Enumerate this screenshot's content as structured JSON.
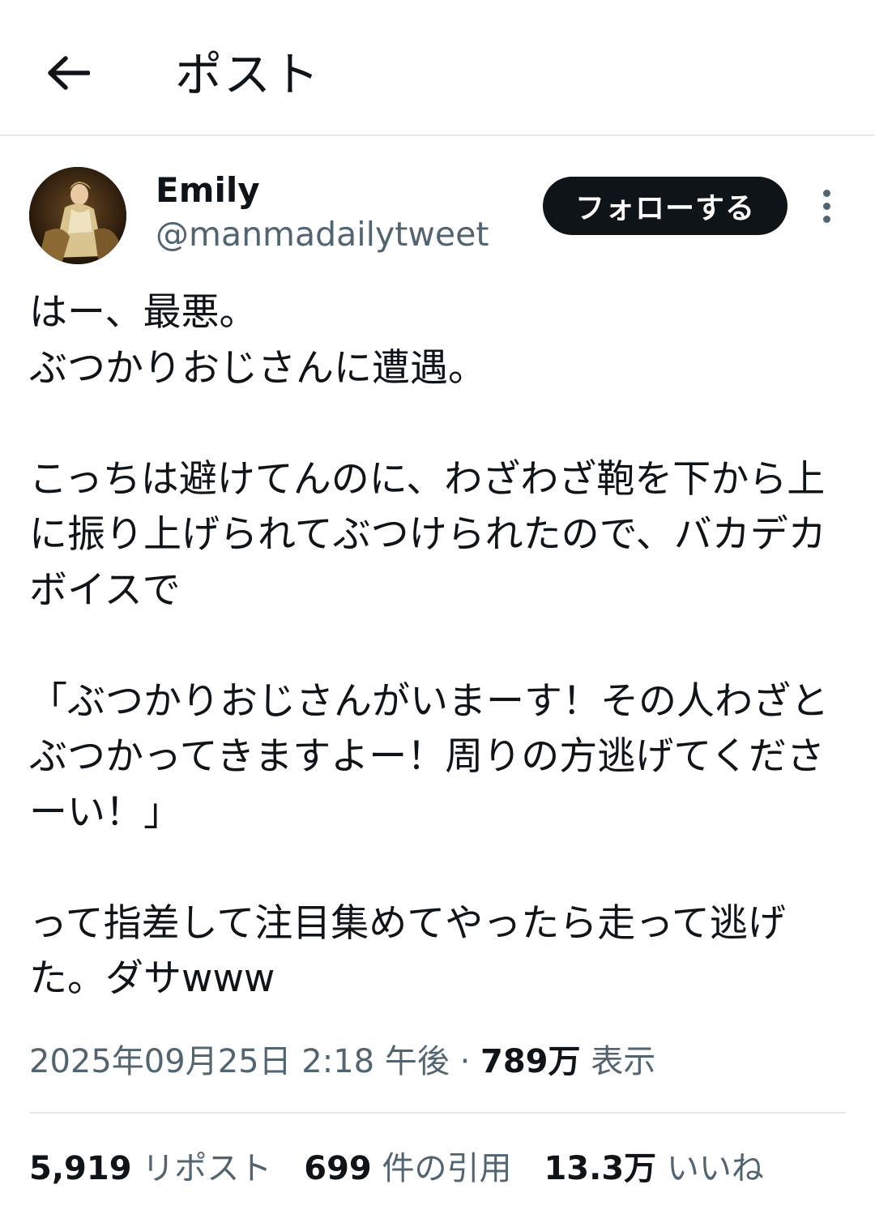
{
  "header": {
    "title": "ポスト",
    "back_icon": "arrow-left-icon"
  },
  "author": {
    "display_name": "Emily",
    "handle": "@manmadailytweet",
    "follow_label": "フォローする"
  },
  "post": {
    "text": "はー、最悪。\nぶつかりおじさんに遭遇。\n\nこっちは避けてんのに、わざわざ鞄を下から上に振り上げられてぶつけられたので、バカデカボイスで\n\n「ぶつかりおじさんがいまーす！その人わざとぶつかってきますよー！周りの方逃げてくださーい！」\n\nって指差して注目集めてやったら走って逃げた。ダサwww"
  },
  "meta": {
    "timestamp": "2025年09月25日 2:18 午後",
    "separator": "·",
    "views_count": "789万",
    "views_label": "表示"
  },
  "stats": {
    "reposts_count": "5,919",
    "reposts_label": "リポスト",
    "quotes_count": "699",
    "quotes_label": "件の引用",
    "likes_count": "13.3万",
    "likes_label": "いいね"
  }
}
